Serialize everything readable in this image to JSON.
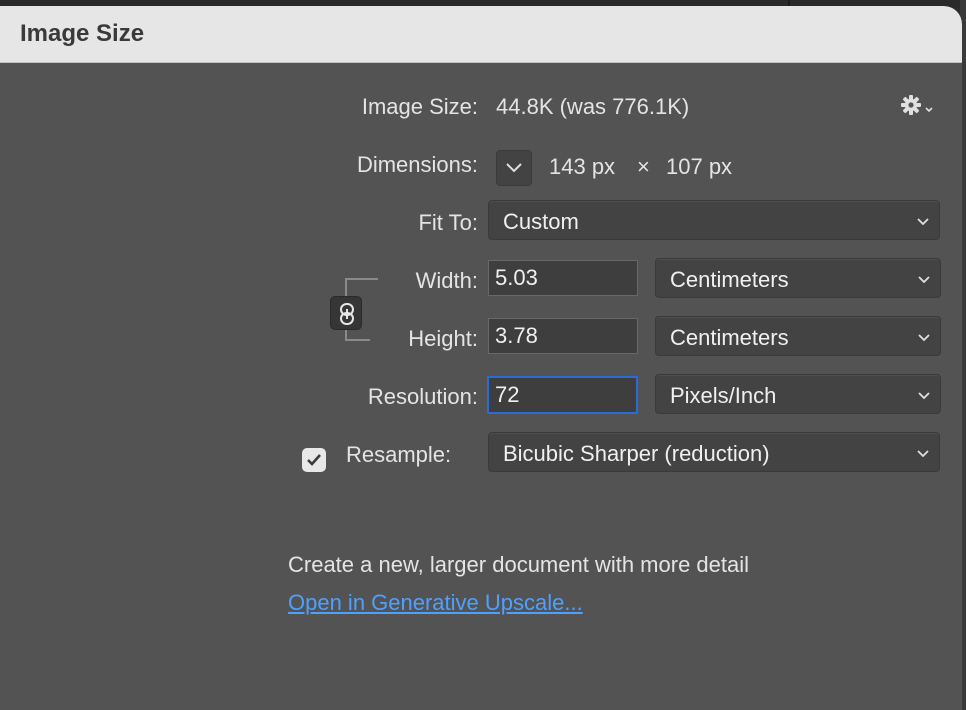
{
  "dialog": {
    "title": "Image Size"
  },
  "image_size": {
    "label": "Image Size:",
    "value": "44.8K (was 776.1K)"
  },
  "settings_icon": "gear-icon",
  "dimensions": {
    "label": "Dimensions:",
    "width_value": "143 px",
    "times": "×",
    "height_value": "107 px"
  },
  "fit_to": {
    "label": "Fit To:",
    "selected": "Custom"
  },
  "width": {
    "label": "Width:",
    "value": "5.03",
    "unit": "Centimeters"
  },
  "height": {
    "label": "Height:",
    "value": "3.78",
    "unit": "Centimeters"
  },
  "resolution": {
    "label": "Resolution:",
    "value": "72",
    "unit": "Pixels/Inch"
  },
  "resample": {
    "checked": true,
    "label": "Resample:",
    "selected": "Bicubic Sharper (reduction)"
  },
  "upscale": {
    "description": "Create a new, larger document with more detail",
    "link": "Open in Generative Upscale..."
  },
  "colors": {
    "dialog_bg": "#535353",
    "titlebar_bg": "#e6e6e6",
    "control_bg": "#434343",
    "focus_ring": "#2b6bd8",
    "link": "#4ea0ff"
  }
}
